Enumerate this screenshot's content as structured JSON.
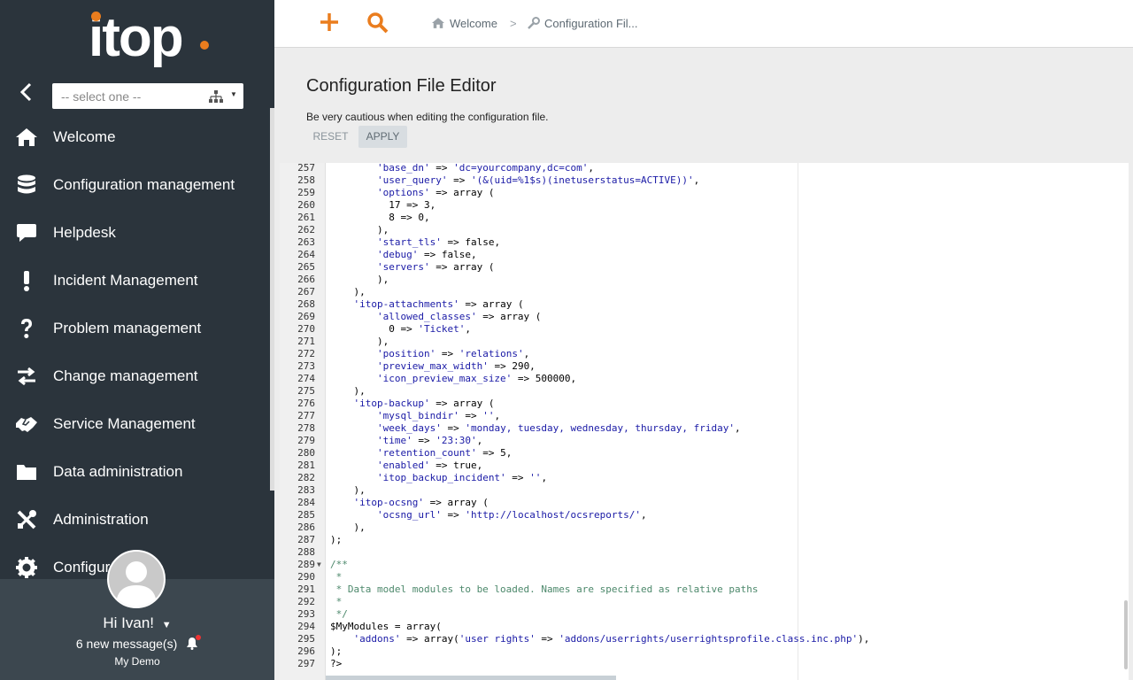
{
  "app": {
    "logo_text": "itop",
    "brand_color": "#ea7d1e",
    "sidebar_color": "#2b343c"
  },
  "sidebar": {
    "org_select": {
      "placeholder": "-- select one --"
    },
    "items": [
      {
        "label": "Welcome",
        "icon": "home-icon"
      },
      {
        "label": "Configuration management",
        "icon": "database-icon"
      },
      {
        "label": "Helpdesk",
        "icon": "chat-bubble-icon"
      },
      {
        "label": "Incident Management",
        "icon": "exclamation-icon"
      },
      {
        "label": "Problem management",
        "icon": "question-icon"
      },
      {
        "label": "Change management",
        "icon": "exchange-arrows-icon"
      },
      {
        "label": "Service Management",
        "icon": "handshake-icon"
      },
      {
        "label": "Data administration",
        "icon": "folder-icon"
      },
      {
        "label": "Administration",
        "icon": "tools-icon"
      },
      {
        "label": "Configur",
        "icon": "gear-icon"
      }
    ],
    "user": {
      "greeting": "Hi Ivan!",
      "messages": "6 new message(s)",
      "organization": "My Demo"
    }
  },
  "topbar": {
    "breadcrumb": [
      {
        "label": "Welcome",
        "icon": "home-icon"
      },
      {
        "label": "Configuration Fil...",
        "icon": "wrench-icon"
      }
    ]
  },
  "main": {
    "title": "Configuration File Editor",
    "caution": "Be very cautious when editing the configuration file.",
    "reset_label": "RESET",
    "apply_label": "APPLY"
  },
  "editor": {
    "lines": [
      {
        "n": "257",
        "code": "        'base_dn' => 'dc=yourcompany,dc=com',"
      },
      {
        "n": "258",
        "code": "        'user_query' => '(&(uid=%1$s)(inetuserstatus=ACTIVE))',"
      },
      {
        "n": "259",
        "code": "        'options' => array ("
      },
      {
        "n": "260",
        "code": "          17 => 3,"
      },
      {
        "n": "261",
        "code": "          8 => 0,"
      },
      {
        "n": "262",
        "code": "        ),"
      },
      {
        "n": "263",
        "code": "        'start_tls' => false,"
      },
      {
        "n": "264",
        "code": "        'debug' => false,"
      },
      {
        "n": "265",
        "code": "        'servers' => array ("
      },
      {
        "n": "266",
        "code": "        ),"
      },
      {
        "n": "267",
        "code": "    ),"
      },
      {
        "n": "268",
        "code": "    'itop-attachments' => array ("
      },
      {
        "n": "269",
        "code": "        'allowed_classes' => array ("
      },
      {
        "n": "270",
        "code": "          0 => 'Ticket',"
      },
      {
        "n": "271",
        "code": "        ),"
      },
      {
        "n": "272",
        "code": "        'position' => 'relations',"
      },
      {
        "n": "273",
        "code": "        'preview_max_width' => 290,"
      },
      {
        "n": "274",
        "code": "        'icon_preview_max_size' => 500000,"
      },
      {
        "n": "275",
        "code": "    ),"
      },
      {
        "n": "276",
        "code": "    'itop-backup' => array ("
      },
      {
        "n": "277",
        "code": "        'mysql_bindir' => '',"
      },
      {
        "n": "278",
        "code": "        'week_days' => 'monday, tuesday, wednesday, thursday, friday',"
      },
      {
        "n": "279",
        "code": "        'time' => '23:30',"
      },
      {
        "n": "280",
        "code": "        'retention_count' => 5,"
      },
      {
        "n": "281",
        "code": "        'enabled' => true,"
      },
      {
        "n": "282",
        "code": "        'itop_backup_incident' => '',"
      },
      {
        "n": "283",
        "code": "    ),"
      },
      {
        "n": "284",
        "code": "    'itop-ocsng' => array ("
      },
      {
        "n": "285",
        "code": "        'ocsng_url' => 'http://localhost/ocsreports/',"
      },
      {
        "n": "286",
        "code": "    ),"
      },
      {
        "n": "287",
        "code": ");"
      },
      {
        "n": "288",
        "code": ""
      },
      {
        "n": "289",
        "code": "/**",
        "fold": true
      },
      {
        "n": "290",
        "code": " *"
      },
      {
        "n": "291",
        "code": " * Data model modules to be loaded. Names are specified as relative paths"
      },
      {
        "n": "292",
        "code": " *"
      },
      {
        "n": "293",
        "code": " */"
      },
      {
        "n": "294",
        "code": "$MyModules = array("
      },
      {
        "n": "295",
        "code": "    'addons' => array('user rights' => 'addons/userrights/userrightsprofile.class.inc.php'),"
      },
      {
        "n": "296",
        "code": ");"
      },
      {
        "n": "297",
        "code": "?>"
      }
    ]
  }
}
